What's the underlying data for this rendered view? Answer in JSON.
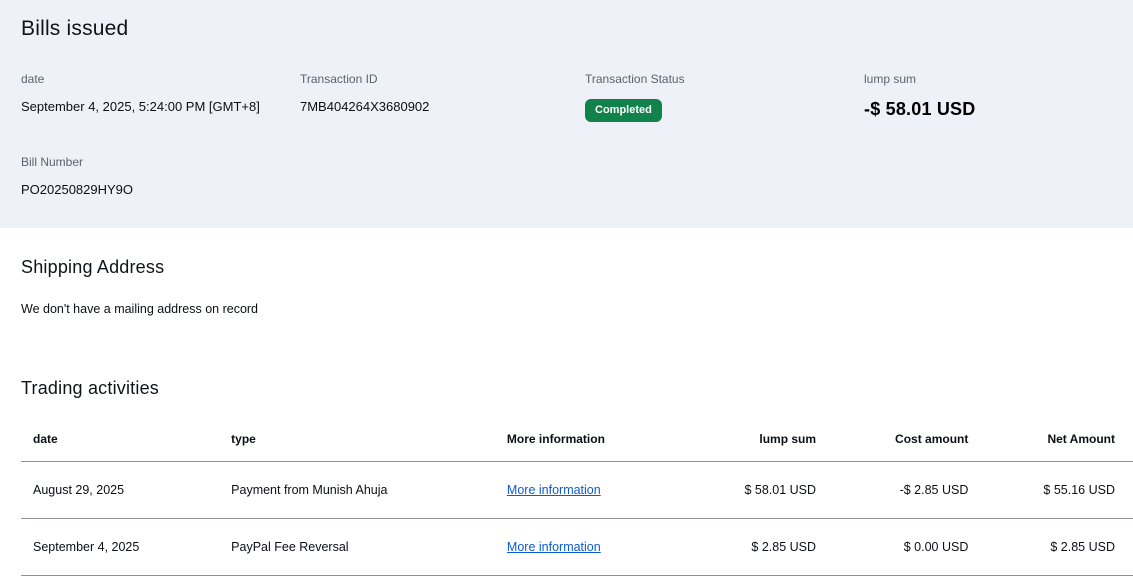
{
  "page": {
    "title": "Bills issued"
  },
  "summary": {
    "date_label": "date",
    "date_value": "September 4, 2025, 5:24:00 PM [GMT+8]",
    "transaction_id_label": "Transaction ID",
    "transaction_id_value": "7MB404264X3680902",
    "status_label": "Transaction Status",
    "status_value": "Completed",
    "lump_sum_label": "lump sum",
    "lump_sum_value": "-$ 58.01 USD",
    "bill_number_label": "Bill Number",
    "bill_number_value": "PO20250829HY9O"
  },
  "shipping": {
    "heading": "Shipping Address",
    "message": "We don't have a mailing address on record"
  },
  "trading": {
    "heading": "Trading activities",
    "columns": {
      "date": "date",
      "type": "type",
      "more_info": "More information",
      "lump_sum": "lump sum",
      "cost_amount": "Cost amount",
      "net_amount": "Net Amount"
    },
    "rows": [
      {
        "date": "August 29, 2025",
        "type": "Payment from Munish Ahuja",
        "more_info": "More information",
        "lump_sum": "$ 58.01 USD",
        "cost_amount": "-$ 2.85 USD",
        "net_amount": "$ 55.16 USD"
      },
      {
        "date": "September 4, 2025",
        "type": "PayPal Fee Reversal",
        "more_info": "More information",
        "lump_sum": "$ 2.85 USD",
        "cost_amount": "$ 0.00 USD",
        "net_amount": "$ 2.85 USD"
      }
    ]
  },
  "colors": {
    "header_band_bg": "#eef1f8",
    "status_badge_bg": "#12824c",
    "link_blue": "#0b5bd3",
    "divider_gray": "#8f9296"
  }
}
